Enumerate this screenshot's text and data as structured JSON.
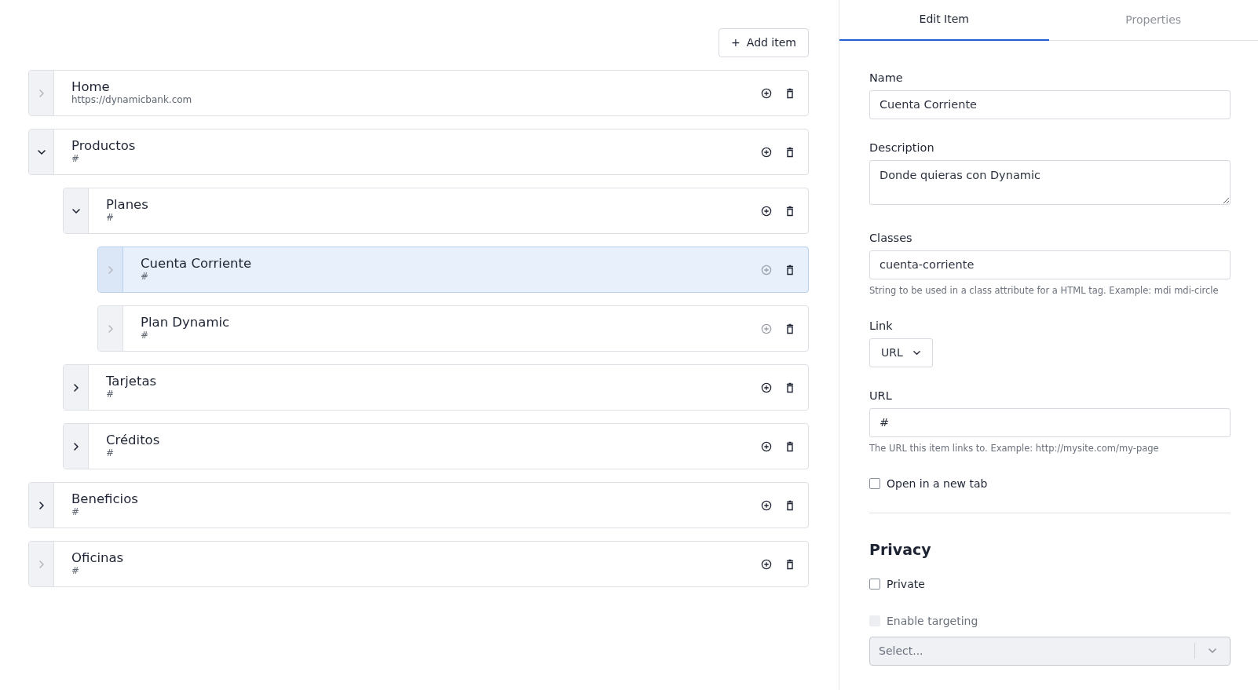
{
  "add_button": {
    "icon": "+",
    "label": "Add item"
  },
  "tree": [
    {
      "title": "Home",
      "link": "https://dynamicbank.com",
      "expanded": false,
      "toggle_disabled": true,
      "add_disabled": false,
      "selected": false
    },
    {
      "title": "Productos",
      "link": "#",
      "expanded": true,
      "toggle_disabled": false,
      "add_disabled": false,
      "selected": false,
      "children": [
        {
          "title": "Planes",
          "link": "#",
          "expanded": true,
          "toggle_disabled": false,
          "add_disabled": false,
          "selected": false,
          "children": [
            {
              "title": "Cuenta Corriente",
              "link": "#",
              "expanded": false,
              "toggle_disabled": true,
              "add_disabled": true,
              "selected": true
            },
            {
              "title": "Plan Dynamic",
              "link": "#",
              "expanded": false,
              "toggle_disabled": true,
              "add_disabled": true,
              "selected": false
            }
          ]
        },
        {
          "title": "Tarjetas",
          "link": "#",
          "expanded": false,
          "toggle_disabled": false,
          "add_disabled": false,
          "selected": false
        },
        {
          "title": "Créditos",
          "link": "#",
          "expanded": false,
          "toggle_disabled": false,
          "add_disabled": false,
          "selected": false
        }
      ]
    },
    {
      "title": "Beneficios",
      "link": "#",
      "expanded": false,
      "toggle_disabled": false,
      "add_disabled": false,
      "selected": false
    },
    {
      "title": "Oficinas",
      "link": "#",
      "expanded": false,
      "toggle_disabled": true,
      "add_disabled": false,
      "selected": false
    }
  ],
  "panel": {
    "tabs": [
      {
        "label": "Edit Item",
        "selected": true
      },
      {
        "label": "Properties",
        "selected": false
      }
    ],
    "fields": [
      {
        "kind": "input",
        "label": "Name",
        "value": "Cuenta Corriente"
      },
      {
        "kind": "textarea",
        "label": "Description",
        "value": "Donde quieras con Dynamic"
      },
      {
        "kind": "input",
        "label": "Classes",
        "value": "cuenta-corriente",
        "help": "String to be used in a class attribute for a HTML tag. Example: mdi mdi-circle"
      },
      {
        "kind": "dropdown",
        "label": "Link",
        "value": "URL"
      },
      {
        "kind": "input",
        "label": "URL",
        "value": "#",
        "help": "The URL this item links to. Example: http://mysite.com/my-page"
      },
      {
        "kind": "checkbox",
        "label": "Open in a new tab",
        "checked": false,
        "disabled": false
      },
      {
        "kind": "divider"
      },
      {
        "kind": "heading",
        "label": "Privacy"
      },
      {
        "kind": "checkbox",
        "label": "Private",
        "checked": false,
        "disabled": false
      },
      {
        "kind": "checkbox",
        "label": "Enable targeting",
        "checked": false,
        "disabled": true
      },
      {
        "kind": "select",
        "placeholder": "Select...",
        "disabled": true
      }
    ]
  }
}
